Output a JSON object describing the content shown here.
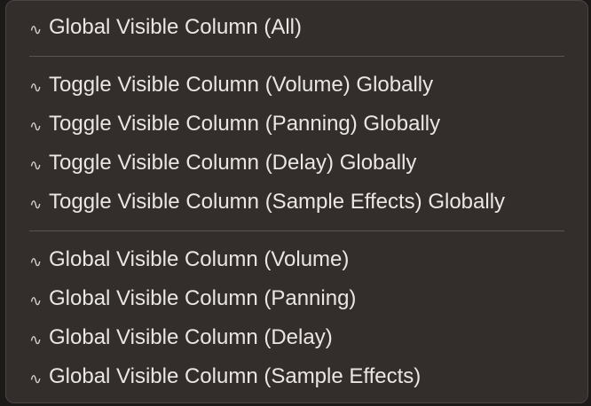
{
  "glyph": "∿",
  "colors": {
    "menu_background": "#332e2c",
    "text": "#e9e6e4",
    "separator": "#5a5452"
  },
  "menu": {
    "group1": [
      "Global Visible Column (All)"
    ],
    "group2": [
      "Toggle Visible Column (Volume) Globally",
      "Toggle Visible Column (Panning) Globally",
      "Toggle Visible Column (Delay) Globally",
      "Toggle Visible Column (Sample Effects) Globally"
    ],
    "group3": [
      "Global Visible Column (Volume)",
      "Global Visible Column (Panning)",
      "Global Visible Column (Delay)",
      "Global Visible Column (Sample Effects)"
    ]
  }
}
